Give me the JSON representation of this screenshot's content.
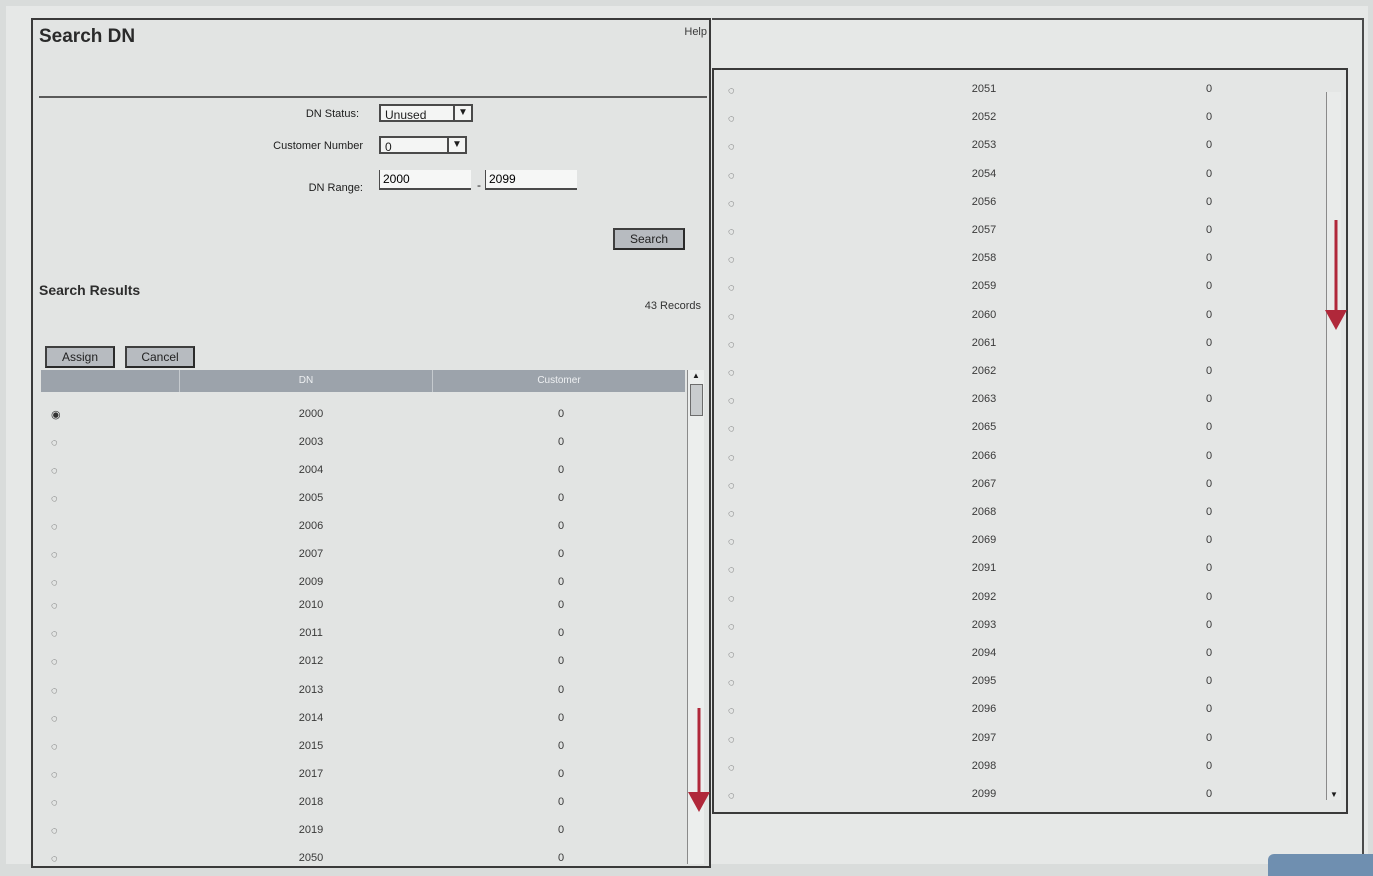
{
  "dialog": {
    "title": "Search DN",
    "help": "Help"
  },
  "form": {
    "dn_status_label": "DN Status:",
    "dn_status_value": "Unused",
    "customer_number_label": "Customer Number",
    "customer_number_value": "0",
    "dn_range_label": "DN Range:",
    "dn_range_from": "2000",
    "dn_range_sep": "-",
    "dn_range_to": "2099",
    "search_button": "Search"
  },
  "results": {
    "title": "Search Results",
    "count": "43 Records",
    "assign_button": "Assign",
    "cancel_button": "Cancel",
    "columns": [
      "",
      "DN",
      "Customer"
    ]
  },
  "left_rows": [
    {
      "dn": "2000",
      "customer": "0",
      "selected": true
    },
    {
      "dn": "2003",
      "customer": "0",
      "selected": false
    },
    {
      "dn": "2004",
      "customer": "0",
      "selected": false
    },
    {
      "dn": "2005",
      "customer": "0",
      "selected": false
    },
    {
      "dn": "2006",
      "customer": "0",
      "selected": false
    },
    {
      "dn": "2007",
      "customer": "0",
      "selected": false
    },
    {
      "dn": "2009",
      "customer": "0",
      "selected": false
    },
    {
      "dn": "2010",
      "customer": "0",
      "selected": false
    },
    {
      "dn": "2011",
      "customer": "0",
      "selected": false
    },
    {
      "dn": "2012",
      "customer": "0",
      "selected": false
    },
    {
      "dn": "2013",
      "customer": "0",
      "selected": false
    },
    {
      "dn": "2014",
      "customer": "0",
      "selected": false
    },
    {
      "dn": "2015",
      "customer": "0",
      "selected": false
    },
    {
      "dn": "2017",
      "customer": "0",
      "selected": false
    },
    {
      "dn": "2018",
      "customer": "0",
      "selected": false
    },
    {
      "dn": "2019",
      "customer": "0",
      "selected": false
    },
    {
      "dn": "2050",
      "customer": "0",
      "selected": false
    }
  ],
  "right_rows": [
    {
      "dn": "2051",
      "customer": "0"
    },
    {
      "dn": "2052",
      "customer": "0"
    },
    {
      "dn": "2053",
      "customer": "0"
    },
    {
      "dn": "2054",
      "customer": "0"
    },
    {
      "dn": "2056",
      "customer": "0"
    },
    {
      "dn": "2057",
      "customer": "0"
    },
    {
      "dn": "2058",
      "customer": "0"
    },
    {
      "dn": "2059",
      "customer": "0"
    },
    {
      "dn": "2060",
      "customer": "0"
    },
    {
      "dn": "2061",
      "customer": "0"
    },
    {
      "dn": "2062",
      "customer": "0"
    },
    {
      "dn": "2063",
      "customer": "0"
    },
    {
      "dn": "2065",
      "customer": "0"
    },
    {
      "dn": "2066",
      "customer": "0"
    },
    {
      "dn": "2067",
      "customer": "0"
    },
    {
      "dn": "2068",
      "customer": "0"
    },
    {
      "dn": "2069",
      "customer": "0"
    },
    {
      "dn": "2091",
      "customer": "0"
    },
    {
      "dn": "2092",
      "customer": "0"
    },
    {
      "dn": "2093",
      "customer": "0"
    },
    {
      "dn": "2094",
      "customer": "0"
    },
    {
      "dn": "2095",
      "customer": "0"
    },
    {
      "dn": "2096",
      "customer": "0"
    },
    {
      "dn": "2097",
      "customer": "0"
    },
    {
      "dn": "2098",
      "customer": "0"
    },
    {
      "dn": "2099",
      "customer": "0"
    }
  ],
  "colors": {
    "annotation_arrow": "#b0283a",
    "table_header": "#9ca3ab",
    "button": "#b7bbc0"
  }
}
